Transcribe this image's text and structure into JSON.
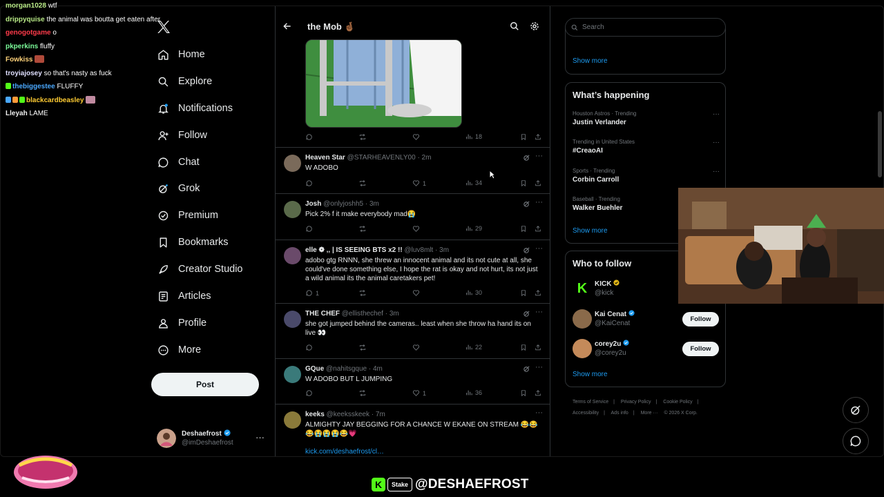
{
  "chat": [
    {
      "user": "morgan1028",
      "msg": "wtf",
      "color": "#b8e986"
    },
    {
      "user": "drippyquise",
      "msg": "the animal was boutta get eaten after",
      "color": "#b8e986"
    },
    {
      "user": "genogotgame",
      "msg": "o",
      "color": "#ff3b4a"
    },
    {
      "user": "pkperkins",
      "msg": "fluffy",
      "color": "#7cfc9a"
    },
    {
      "user": "Fowkiss",
      "msg": "",
      "color": "#ffd27a",
      "emote": true
    },
    {
      "user": "troyiajosey",
      "msg": "so that's nasty as fuck",
      "color": "#e0e0ff"
    },
    {
      "user": "thebiggestee",
      "msg": "FLUFFY",
      "color": "#4aa8ff",
      "badge": true
    },
    {
      "user": "blackcardbeasley",
      "msg": "",
      "color": "#ffcc33",
      "badges": true,
      "emote": true
    },
    {
      "user": "Lleyah",
      "msg": "LAME",
      "color": "#f0f0f0"
    }
  ],
  "nav": {
    "items": [
      {
        "label": "Home",
        "icon": "home-icon"
      },
      {
        "label": "Explore",
        "icon": "search-icon"
      },
      {
        "label": "Notifications",
        "icon": "bell-icon"
      },
      {
        "label": "Follow",
        "icon": "follow-icon"
      },
      {
        "label": "Chat",
        "icon": "chat-icon"
      },
      {
        "label": "Grok",
        "icon": "grok-icon"
      },
      {
        "label": "Premium",
        "icon": "premium-icon"
      },
      {
        "label": "Bookmarks",
        "icon": "bookmark-icon"
      },
      {
        "label": "Creator Studio",
        "icon": "rocket-icon"
      },
      {
        "label": "Articles",
        "icon": "articles-icon"
      },
      {
        "label": "Profile",
        "icon": "profile-icon"
      },
      {
        "label": "More",
        "icon": "more-icon"
      }
    ],
    "post_label": "Post",
    "account": {
      "display_name": "Deshaefrost",
      "handle": "@imDeshaefrost"
    }
  },
  "timeline": {
    "title": "the Mob 🤞🏾",
    "media_stats": {
      "views": "18"
    },
    "tweets": [
      {
        "name": "Heaven Star",
        "handle": "@STARHEAVENLY00",
        "time": "· 2m",
        "text": "W ADOBO",
        "replies": "",
        "reposts": "",
        "likes": "1",
        "views": "34",
        "avatar_color": "#7a6a5a"
      },
      {
        "name": "Josh",
        "handle": "@onlyjoshh5",
        "time": "· 3m",
        "text": "Pick 2% f it make everybody mad😭",
        "replies": "",
        "reposts": "",
        "likes": "",
        "views": "29",
        "avatar_color": "#5a6a4a"
      },
      {
        "name": "elle ❁ ,, | IS SEEING BTS x2 !!",
        "handle": "@luv8mlt",
        "time": "· 3m",
        "text": "adobo gtg RNNN, she threw an innocent animal and its not cute at all, she could've done something else, I hope the rat is okay and not hurt, its not just a wild animal its the animal caretakers pet!",
        "replies": "1",
        "reposts": "",
        "likes": "",
        "views": "30",
        "avatar_color": "#6a4a6a"
      },
      {
        "name": "THE CHEF",
        "handle": "@ellisthechef",
        "time": "· 3m",
        "text": "she got jumped behind the cameras.. least when she throw ha hand its on live 👀",
        "replies": "",
        "reposts": "",
        "likes": "",
        "views": "22",
        "avatar_color": "#4a4a6a"
      },
      {
        "name": "GQue",
        "handle": "@nahitsgque",
        "time": "· 4m",
        "text": "W ADOBO  BUT  L JUMPING",
        "replies": "",
        "reposts": "",
        "likes": "1",
        "views": "36",
        "avatar_color": "#3a7a7a"
      },
      {
        "name": "keeks",
        "handle": "@keeksskeek",
        "time": "· 7m",
        "text": "ALMIGHTY JAY BEGGING FOR A CHANCE W EKANE ON STREAM 😂😂😂😭😭😭😂💗",
        "link": "kick.com/deshaefrost/cl…",
        "avatar_color": "#8a7a3a"
      }
    ]
  },
  "right": {
    "search_placeholder": "Search",
    "top_show_more": "Show more",
    "happening_title": "What’s happening",
    "trends": [
      {
        "context": "Houston Astros · Trending",
        "name": "Justin Verlander"
      },
      {
        "context": "Trending in United States",
        "name": "#CreaoAI"
      },
      {
        "context": "Sports · Trending",
        "name": "Corbin Carroll"
      },
      {
        "context": "Baseball · Trending",
        "name": "Walker Buehler"
      }
    ],
    "happening_show_more": "Show more",
    "wtf_title": "Who to follow",
    "who_to_follow": [
      {
        "name": "KICK",
        "handle": "@kick",
        "button": ""
      },
      {
        "name": "Kai Cenat",
        "handle": "@KaiCenat",
        "button": "Follow"
      },
      {
        "name": "corey2u",
        "handle": "@corey2u",
        "button": "Follow"
      }
    ],
    "wtf_show_more": "Show more",
    "footer": [
      "Terms of Service",
      "|",
      "Privacy Policy",
      "|",
      "Cookie Policy",
      "|",
      "Accessibility",
      "|",
      "Ads info",
      "|",
      "More ···",
      "© 2026 X Corp."
    ]
  },
  "overlay": {
    "kick_letter": "K",
    "stake_label": "Stake",
    "handle": "@DESHAEFROST"
  },
  "colors": {
    "accent": "#1d9bf0",
    "verified": "#1d9bf0",
    "kick": "#53fc18"
  }
}
